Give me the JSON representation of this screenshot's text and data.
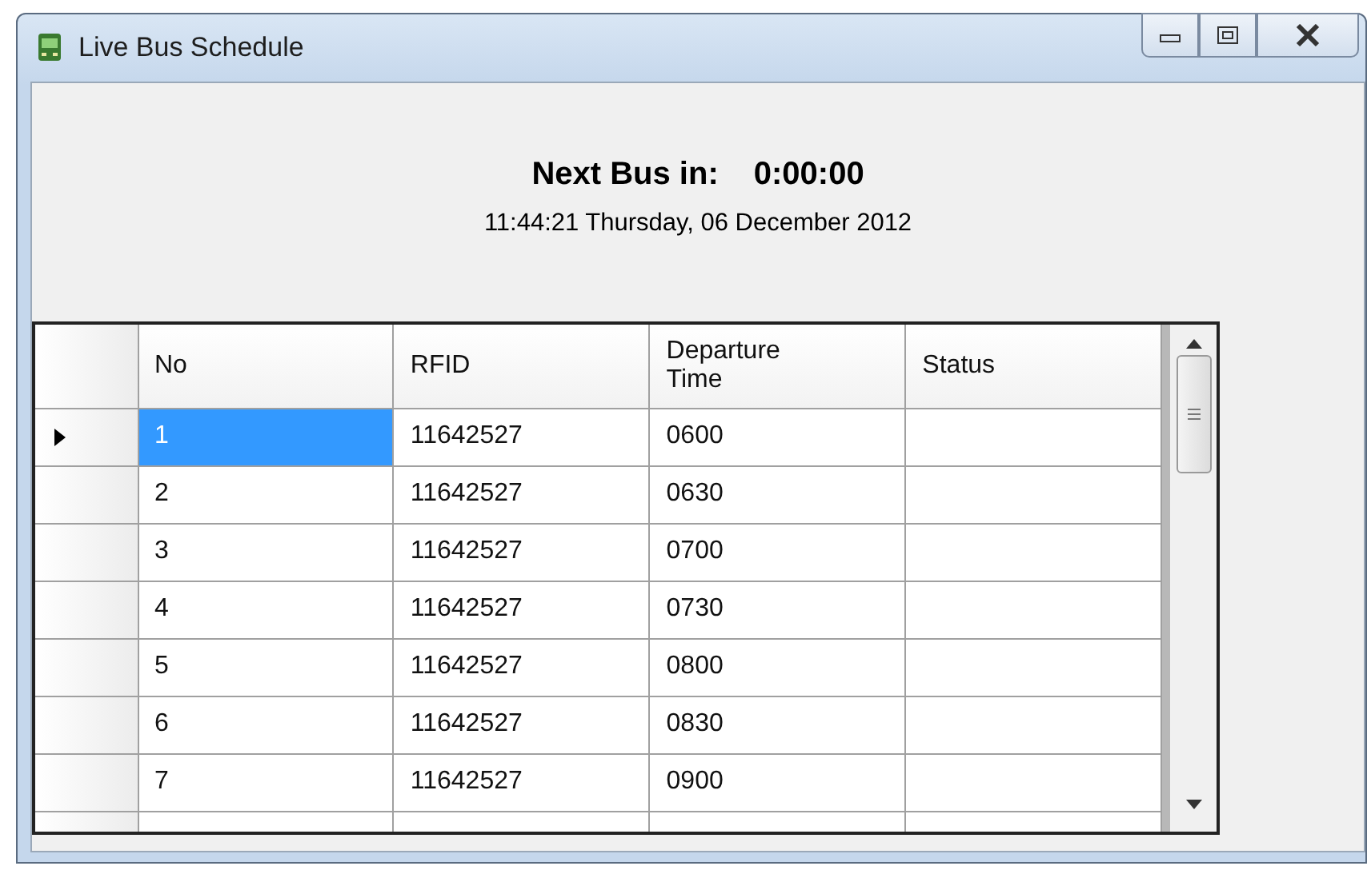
{
  "window": {
    "title": "Live Bus Schedule"
  },
  "next_bus": {
    "label": "Next Bus in:",
    "value": "0:00:00"
  },
  "datetime": "11:44:21 Thursday, 06 December 2012",
  "table": {
    "columns": [
      "No",
      "RFID",
      "Departure Time",
      "Status"
    ],
    "rows": [
      {
        "selected": true,
        "cells": [
          "1",
          "11642527",
          "0600",
          ""
        ]
      },
      {
        "selected": false,
        "cells": [
          "2",
          "11642527",
          "0630",
          ""
        ]
      },
      {
        "selected": false,
        "cells": [
          "3",
          "11642527",
          "0700",
          ""
        ]
      },
      {
        "selected": false,
        "cells": [
          "4",
          "11642527",
          "0730",
          ""
        ]
      },
      {
        "selected": false,
        "cells": [
          "5",
          "11642527",
          "0800",
          ""
        ]
      },
      {
        "selected": false,
        "cells": [
          "6",
          "11642527",
          "0830",
          ""
        ]
      },
      {
        "selected": false,
        "cells": [
          "7",
          "11642527",
          "0900",
          ""
        ]
      }
    ]
  }
}
